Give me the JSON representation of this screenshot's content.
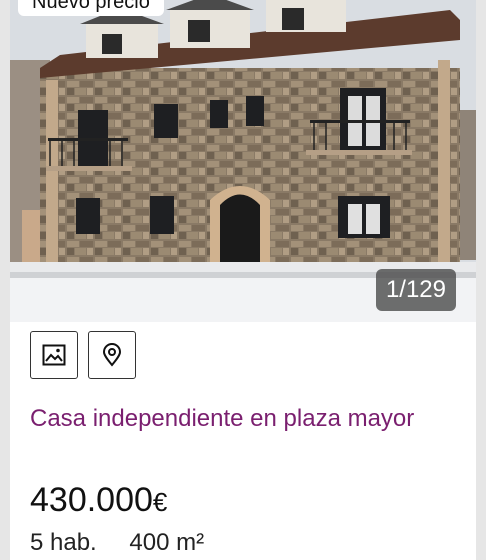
{
  "listing": {
    "badge": "Nuevo precio",
    "photo_counter": "1/129",
    "title": "Casa independiente en plaza mayor",
    "price": "430.000",
    "currency": "€",
    "rooms": "5 hab.",
    "area": "400 m²"
  },
  "icons": {
    "gallery": "image-icon",
    "map": "map-pin-icon"
  },
  "colors": {
    "title": "#7a1f6f",
    "price": "#111111"
  }
}
